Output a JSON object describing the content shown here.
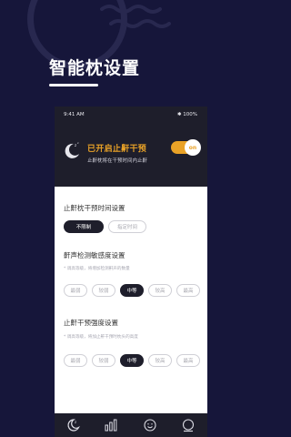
{
  "headline": "智能枕设置",
  "status_bar": {
    "time": "9:41 AM",
    "battery": "100%"
  },
  "snore_toggle": {
    "title": "已开启止鼾干预",
    "description": "止鼾枕将在干预时间内止鼾",
    "switch_label": "on",
    "state": "on"
  },
  "time_settings": {
    "title": "止鼾枕干预时间设置",
    "options": [
      "不限制",
      "指定时间"
    ],
    "selected": "不限制"
  },
  "sensitivity": {
    "title": "鼾声检测敏感度设置",
    "hint": "* 调高等级，将增加检测鼾声的数量",
    "options": [
      "最弱",
      "较弱",
      "中等",
      "较高",
      "最高"
    ],
    "selected": "中等"
  },
  "intensity": {
    "title": "止鼾干预强度设置",
    "hint": "* 调高等级，将加止鼾干预时枕头的高度",
    "options": [
      "最弱",
      "较弱",
      "中等",
      "较高",
      "最高"
    ],
    "selected": "中等"
  },
  "tabbar": {
    "tabs": [
      "sleep-icon",
      "bar-chart-icon",
      "smiley-icon",
      "profile-icon"
    ]
  },
  "colors": {
    "background": "#16163a",
    "accent": "#e9a227",
    "dark_panel": "#1e1e2b"
  }
}
